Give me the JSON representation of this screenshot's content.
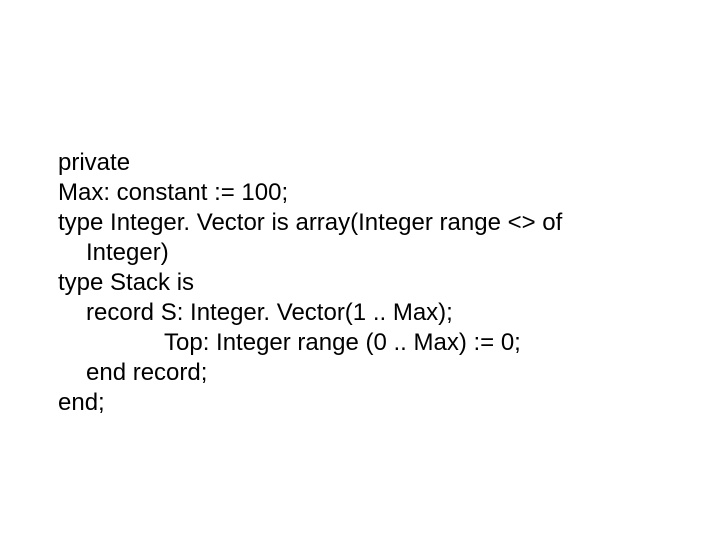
{
  "code": {
    "l1": "private",
    "l2": "Max: constant := 100;",
    "l3": "type Integer. Vector is array(Integer range <> of",
    "l4": "Integer)",
    "l5": "type Stack is",
    "l6": "record S: Integer. Vector(1 .. Max);",
    "l7": "Top: Integer range (0 .. Max) := 0;",
    "l8": "end record;",
    "l9": "end;"
  }
}
